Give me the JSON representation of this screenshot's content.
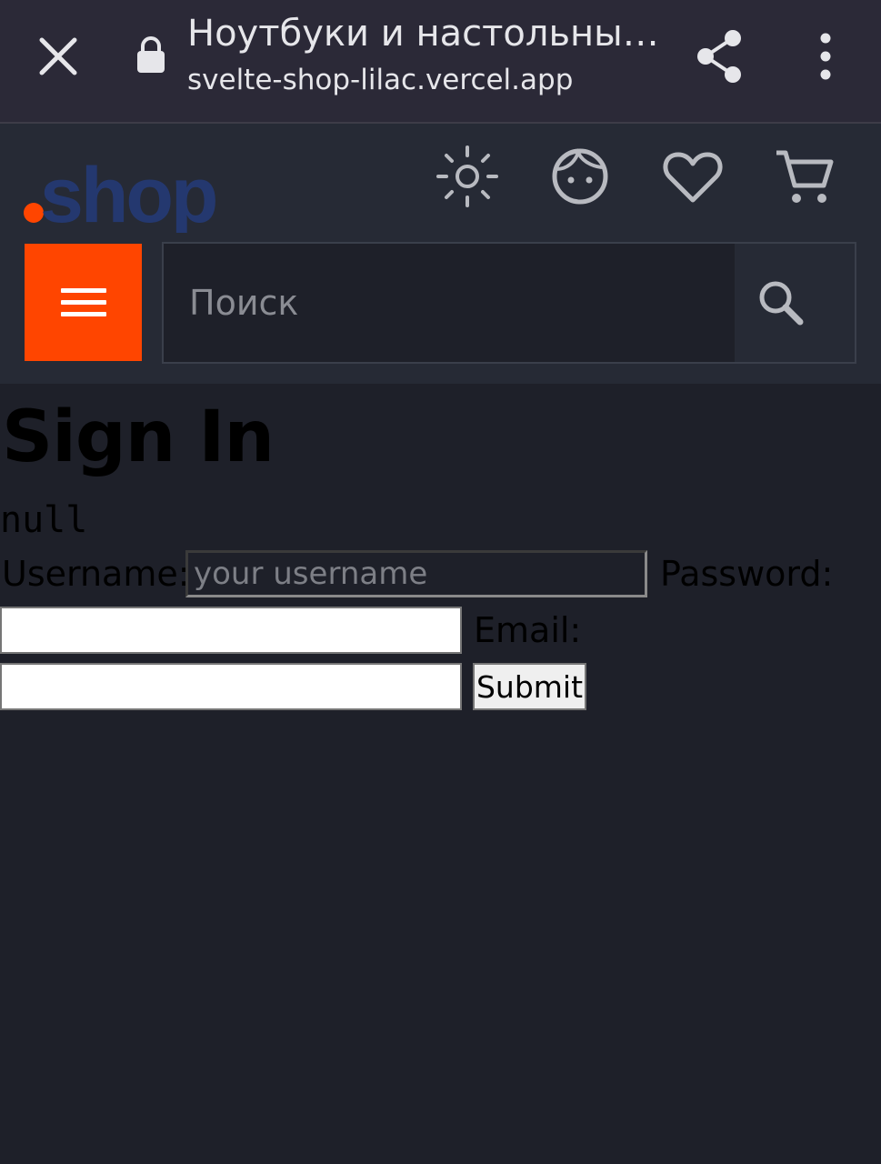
{
  "browser": {
    "tab_title": "Ноутбуки и настольны…",
    "url": "svelte-shop-lilac.vercel.app"
  },
  "site": {
    "logo_text": ".shop",
    "search_placeholder": "Поиск",
    "icons": [
      "sun-icon",
      "face-icon",
      "heart-icon",
      "cart-icon",
      "search-icon",
      "hamburger-menu-icon"
    ],
    "colors": {
      "accent": "#ff4500",
      "logo_blue": "#24386f",
      "header_bg": "#262a35",
      "page_bg": "#1e2029"
    }
  },
  "form": {
    "title": "Sign In",
    "status_text": "null",
    "username_label": "Username:",
    "username_placeholder": "your username",
    "password_label": "Password:",
    "email_label": "Email:",
    "submit_label": "Submit"
  }
}
